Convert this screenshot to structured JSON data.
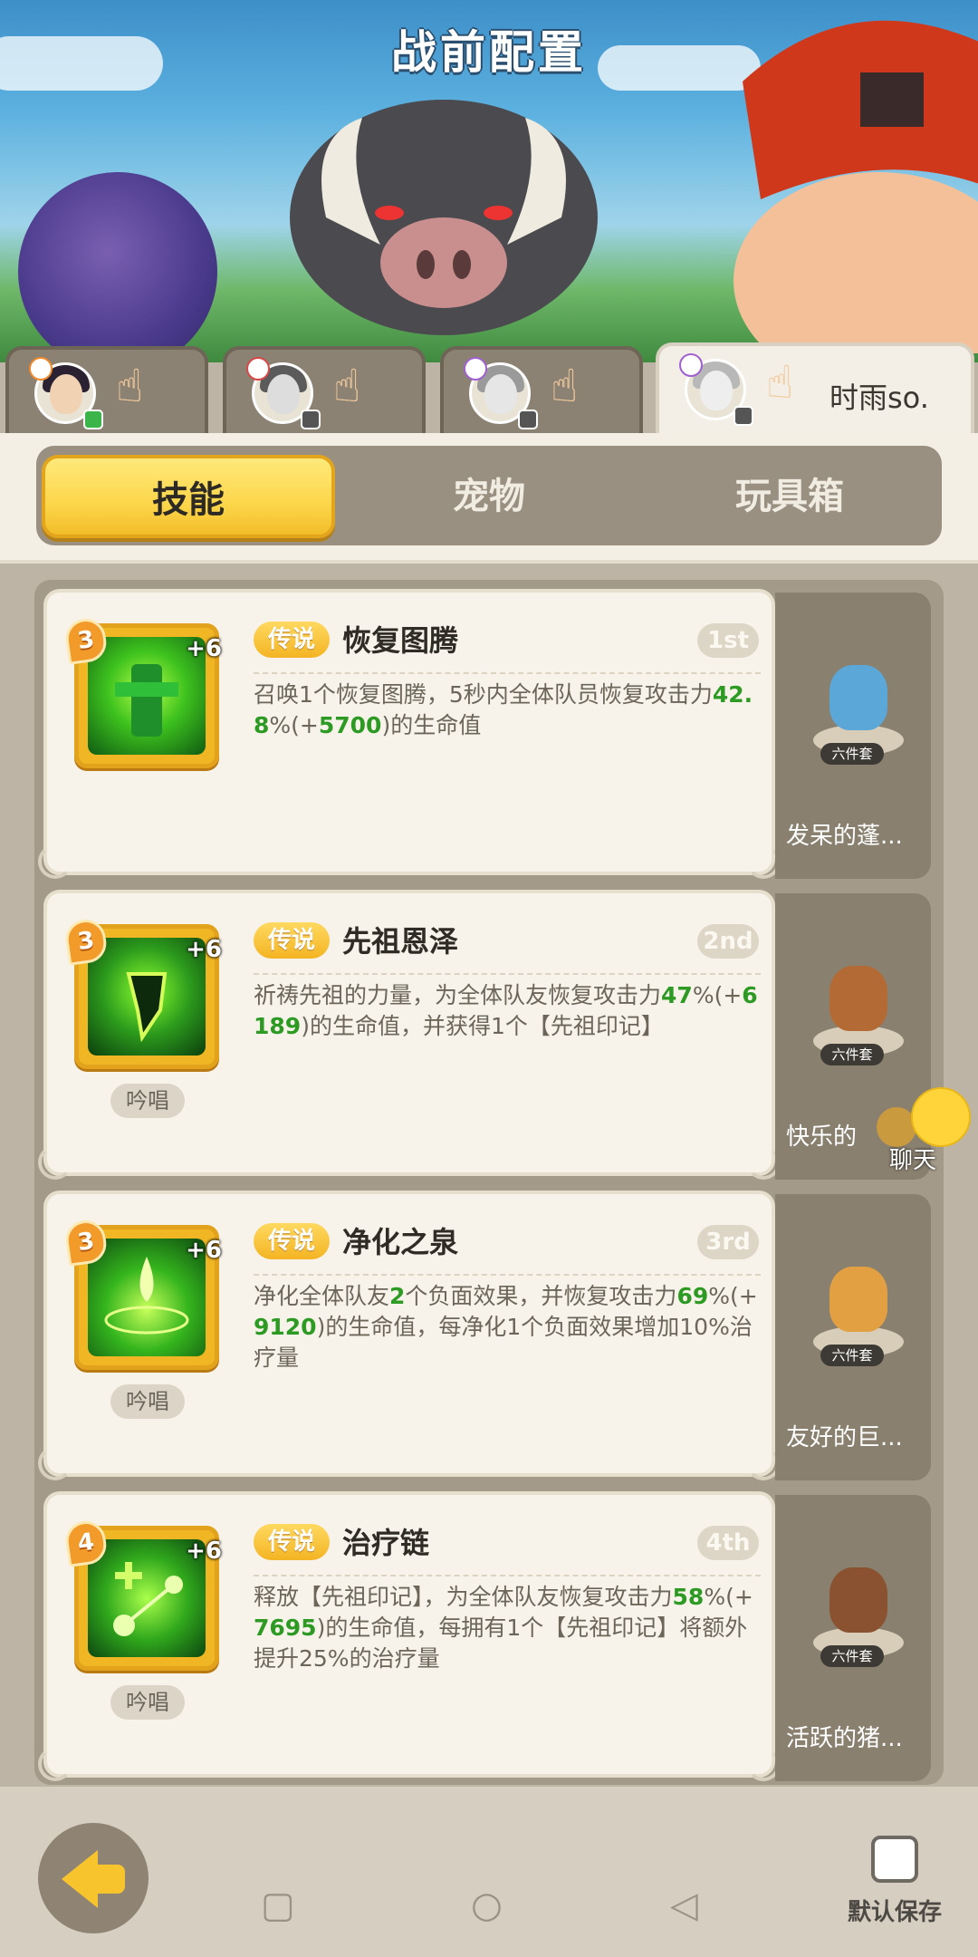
{
  "header": {
    "title": "战前配置"
  },
  "players": [
    {
      "name": ""
    },
    {
      "name": ""
    },
    {
      "name": ""
    },
    {
      "name": "时雨so."
    }
  ],
  "tabs": [
    {
      "label": "技能"
    },
    {
      "label": "宠物"
    },
    {
      "label": "玩具箱"
    }
  ],
  "skills": [
    {
      "level": "3",
      "plus": "+6",
      "rarity": "传说",
      "name": "恢复图腾",
      "rank": "1st",
      "desc_a": "召唤1个恢复图腾，5秒内全体队员恢复攻击力",
      "n1": "42.8",
      "desc_b": "%(+",
      "n2": "5700",
      "desc_c": ")的生命值",
      "chant": ""
    },
    {
      "level": "3",
      "plus": "+6",
      "rarity": "传说",
      "name": "先祖恩泽",
      "rank": "2nd",
      "desc_a": "祈祷先祖的力量，为全体队友恢复攻击力",
      "n1": "47",
      "desc_b": "%(+",
      "n2": "6189",
      "desc_c": ")的生命值，并获得1个【先祖印记】",
      "chant": "吟唱"
    },
    {
      "level": "3",
      "plus": "+6",
      "rarity": "传说",
      "name": "净化之泉",
      "rank": "3rd",
      "desc_a": "净化全体队友",
      "n0": "2",
      "desc_a2": "个负面效果，并恢复攻击力",
      "n1": "69",
      "desc_b": "%(+",
      "n2": "9120",
      "desc_c": ")的生命值，每净化1个负面效果增加10%治疗量",
      "chant": "吟唱"
    },
    {
      "level": "4",
      "plus": "+6",
      "rarity": "传说",
      "name": "治疗链",
      "rank": "4th",
      "desc_a": "释放【先祖印记】，为全体队友恢复攻击力",
      "n1": "58",
      "desc_b": "%(+",
      "n2": "7695",
      "desc_c": ")的生命值，每拥有1个【先祖印记】将额外提升25%的治疗量",
      "chant": "吟唱"
    }
  ],
  "pets": [
    {
      "tag": "六件套",
      "name": "发呆的蓬..."
    },
    {
      "tag": "六件套",
      "name": "快乐的"
    },
    {
      "tag": "六件套",
      "name": "友好的巨..."
    },
    {
      "tag": "六件套",
      "name": "活跃的猪..."
    }
  ],
  "chat": {
    "label": "聊天"
  },
  "footer": {
    "save_label": "默认保存"
  },
  "colors": {
    "accent": "#fcd64a",
    "highlight_number": "#2c9a23",
    "rarity": "#f4b423"
  }
}
